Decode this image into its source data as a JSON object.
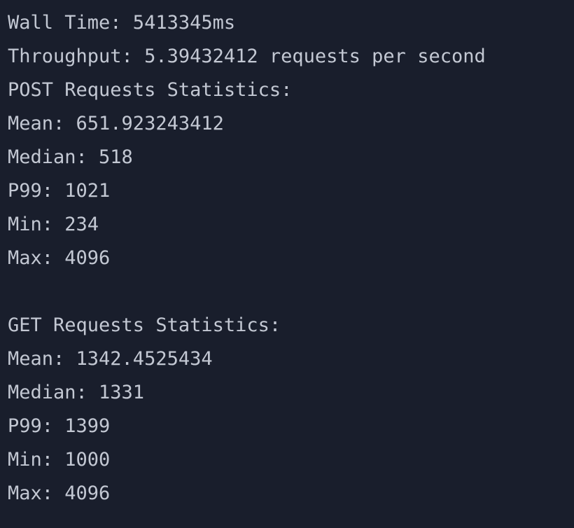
{
  "summary": {
    "wall_time": "Wall Time: 5413345ms",
    "throughput": "Throughput: 5.39432412 requests per second"
  },
  "post_stats": {
    "heading": "POST Requests Statistics:",
    "mean": "Mean: 651.923243412",
    "median": "Median: 518",
    "p99": "P99: 1021",
    "min": "Min: 234",
    "max": "Max: 4096"
  },
  "get_stats": {
    "heading": "GET Requests Statistics:",
    "mean": "Mean: 1342.4525434",
    "median": "Median: 1331",
    "p99": "P99: 1399",
    "min": "Min: 1000",
    "max": "Max: 4096"
  },
  "colors": {
    "background": "#191e2c",
    "text": "#c3c8d3"
  }
}
